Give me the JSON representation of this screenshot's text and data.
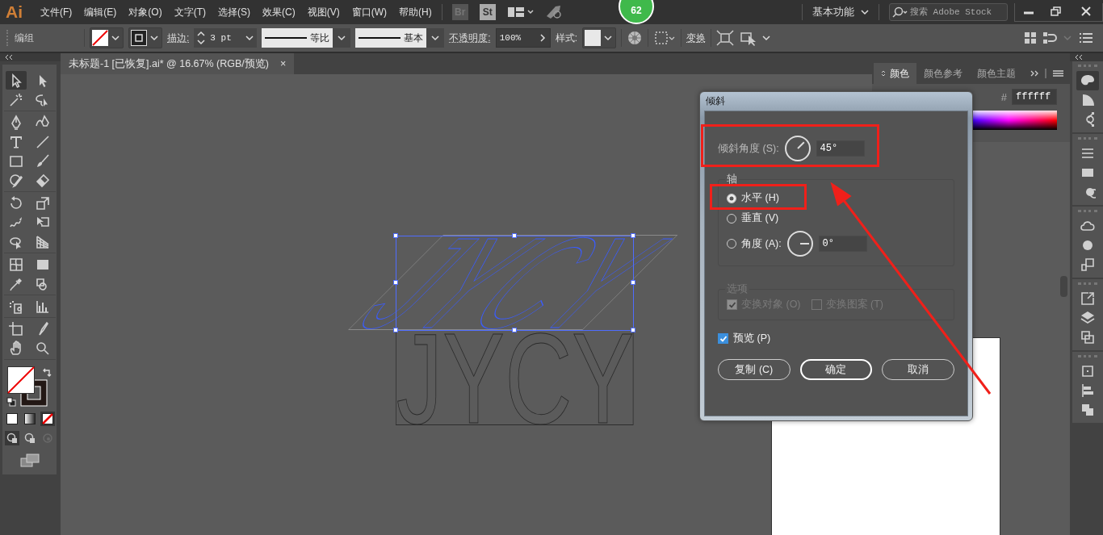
{
  "menu_bar": {
    "logo": "Ai",
    "menus": [
      "文件(F)",
      "编辑(E)",
      "对象(O)",
      "文字(T)",
      "选择(S)",
      "效果(C)",
      "视图(V)",
      "窗口(W)",
      "帮助(H)"
    ],
    "bridge": "Br",
    "stock": "St",
    "badge": "62",
    "workspace": "基本功能",
    "search": {
      "placeholder": "搜索 Adobe Stock"
    }
  },
  "control_bar": {
    "selection_label": "编组",
    "stroke_label": "描边:",
    "stroke_weight": "3 pt",
    "variable_width": "等比",
    "brush": "基本",
    "opacity_label": "不透明度:",
    "opacity": "100%",
    "style_label": "样式:",
    "transform_link": "变换"
  },
  "document_tab": {
    "title": "未标题-1 [已恢复].ai* @ 16.67% (RGB/预览)",
    "close": "×"
  },
  "toolbar": {
    "tool_groups": [
      [
        {
          "kind": "selection",
          "selected": true
        },
        {
          "kind": "direct-selection",
          "selected": false
        },
        {
          "kind": "magic-wand",
          "selected": false
        },
        {
          "kind": "lasso",
          "selected": false
        }
      ],
      [
        {
          "kind": "pen",
          "selected": false
        },
        {
          "kind": "curvature",
          "selected": false
        },
        {
          "kind": "type",
          "selected": false
        },
        {
          "kind": "line",
          "selected": false
        },
        {
          "kind": "rectangle",
          "selected": false
        },
        {
          "kind": "paintbrush",
          "selected": false
        },
        {
          "kind": "shaper",
          "selected": false
        },
        {
          "kind": "eraser",
          "selected": false
        }
      ],
      [
        {
          "kind": "rotate",
          "selected": false
        },
        {
          "kind": "scale",
          "selected": false
        },
        {
          "kind": "warp",
          "selected": false
        },
        {
          "kind": "free-transform",
          "selected": false
        },
        {
          "kind": "shape-builder",
          "selected": false
        },
        {
          "kind": "perspective-grid",
          "selected": false
        }
      ],
      [
        {
          "kind": "mesh",
          "selected": false
        },
        {
          "kind": "gradient",
          "selected": false
        },
        {
          "kind": "eyedropper",
          "selected": false
        },
        {
          "kind": "blend",
          "selected": false
        }
      ],
      [
        {
          "kind": "symbol-sprayer",
          "selected": false
        },
        {
          "kind": "column-graph",
          "selected": false
        }
      ],
      [
        {
          "kind": "artboard",
          "selected": false
        },
        {
          "kind": "slice",
          "selected": false
        },
        {
          "kind": "hand",
          "selected": false
        },
        {
          "kind": "zoom",
          "selected": false
        }
      ]
    ],
    "color_modes": [
      {
        "kind": "color",
        "selected": false
      },
      {
        "kind": "gradient",
        "selected": false
      },
      {
        "kind": "none",
        "selected": true
      }
    ],
    "draw_modes": [
      {
        "kind": "normal",
        "selected": true,
        "disabled": false
      },
      {
        "kind": "behind",
        "selected": false,
        "disabled": false
      },
      {
        "kind": "inside",
        "selected": false,
        "disabled": true
      }
    ]
  },
  "color_panel": {
    "tabs": [
      {
        "label": "颜色",
        "selected": true
      },
      {
        "label": "颜色参考",
        "selected": false
      },
      {
        "label": "颜色主题",
        "selected": false
      }
    ],
    "hex_label": "#",
    "hex_value": "ffffff"
  },
  "dock": {
    "groups": [
      [
        {
          "kind": "color",
          "selected": true
        },
        {
          "kind": "color-guide",
          "selected": false
        },
        {
          "kind": "color-themes",
          "selected": false
        }
      ],
      [
        {
          "kind": "stroke",
          "selected": false
        },
        {
          "kind": "gradient",
          "selected": false
        },
        {
          "kind": "transparency",
          "selected": false
        }
      ],
      [
        {
          "kind": "libraries",
          "selected": false
        },
        {
          "kind": "appearance",
          "selected": false
        },
        {
          "kind": "graphic-styles",
          "selected": false
        }
      ],
      [
        {
          "kind": "export",
          "selected": false
        },
        {
          "kind": "layers",
          "selected": false
        },
        {
          "kind": "artboards",
          "selected": false
        }
      ],
      [
        {
          "kind": "transform",
          "selected": false
        },
        {
          "kind": "align",
          "selected": false
        },
        {
          "kind": "pathfinder",
          "selected": false
        }
      ]
    ]
  },
  "canvas": {
    "artwork_text": "JYCY",
    "preview_text": "JYCY"
  },
  "dialog": {
    "title": "倾斜",
    "skew_angle": {
      "label": "倾斜角度 (S):",
      "value": "45°"
    },
    "axis": {
      "title": "轴",
      "options": [
        {
          "kind": "plain",
          "label": "水平 (H)",
          "selected": true
        },
        {
          "kind": "plain",
          "label": "垂直 (V)",
          "selected": false
        },
        {
          "kind": "angle",
          "label": "角度 (A):",
          "value": "0°",
          "selected": false
        }
      ]
    },
    "options": {
      "title": "选项",
      "disabled": true,
      "checkboxes": [
        {
          "label": "变换对象 (O)",
          "checked": true
        },
        {
          "label": "变换图案 (T)",
          "checked": false
        }
      ]
    },
    "preview": {
      "label": "预览 (P)",
      "checked": true
    },
    "buttons": [
      {
        "label": "复制 (C)",
        "default": false
      },
      {
        "label": "确定",
        "default": true
      },
      {
        "label": "取消",
        "default": false
      }
    ]
  }
}
